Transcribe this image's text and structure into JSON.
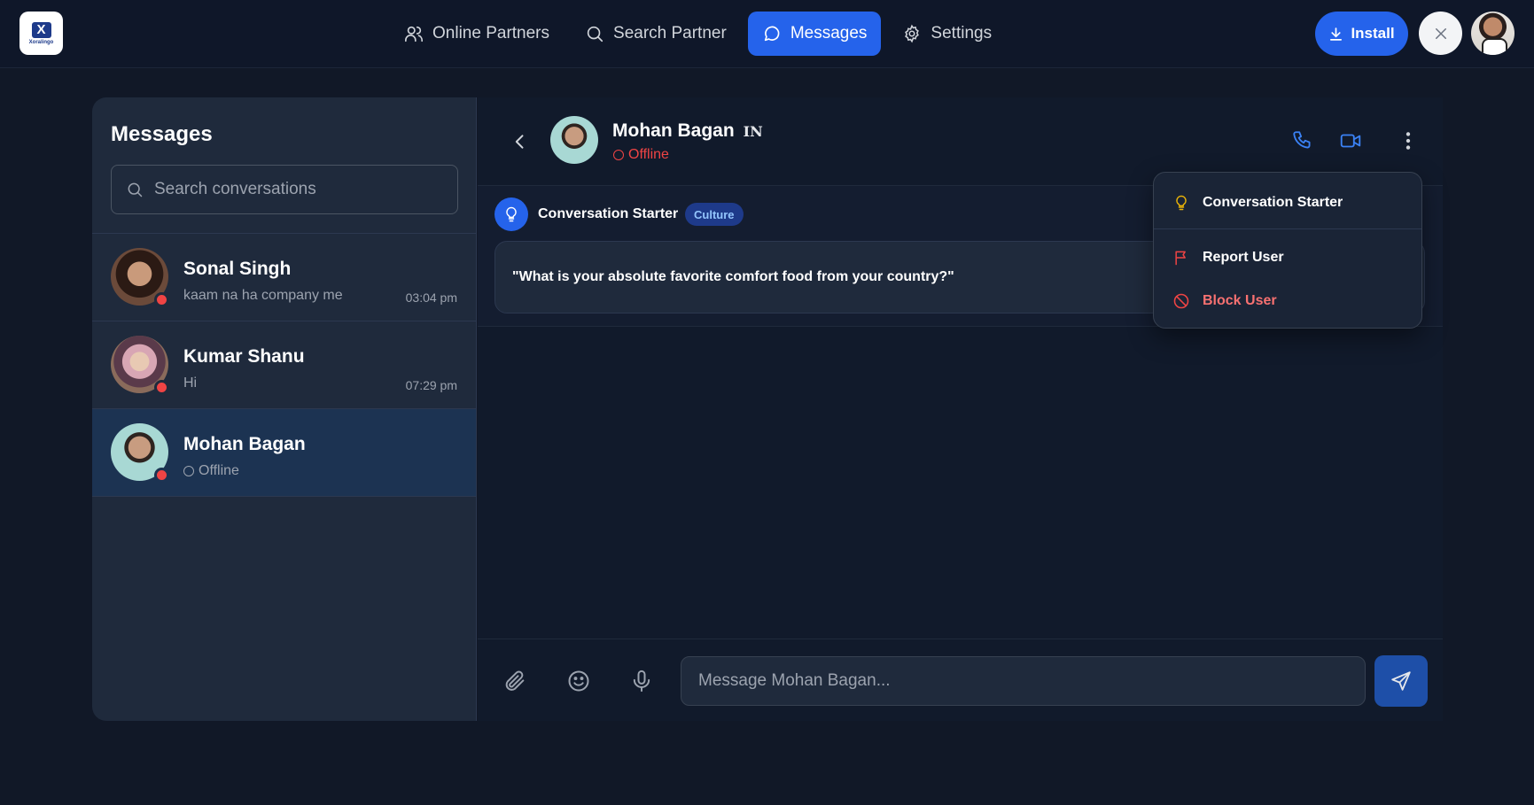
{
  "app": {
    "logo_text": "Xoralingo"
  },
  "nav": {
    "items": [
      {
        "label": "Online Partners",
        "icon": "users-icon"
      },
      {
        "label": "Search Partner",
        "icon": "search-icon"
      },
      {
        "label": "Messages",
        "icon": "chat-bubble-icon",
        "active": true
      },
      {
        "label": "Settings",
        "icon": "gear-icon"
      }
    ],
    "install_label": "Install"
  },
  "sidebar": {
    "title": "Messages",
    "search_placeholder": "Search conversations",
    "conversations": [
      {
        "name": "Sonal Singh",
        "preview": "kaam na ha company me",
        "time": "03:04 pm",
        "status": "offline"
      },
      {
        "name": "Kumar Shanu",
        "preview": "Hi",
        "time": "07:29 pm",
        "status": "offline"
      },
      {
        "name": "Mohan Bagan",
        "preview": "Offline",
        "time": "",
        "status": "offline",
        "active": true
      }
    ]
  },
  "chat": {
    "name": "Mohan Bagan",
    "country_code": "IN",
    "status": "Offline",
    "starter": {
      "title": "Conversation Starter",
      "tag": "Culture",
      "question": "\"What is your absolute favorite comfort food from your country?\""
    },
    "composer_placeholder": "Message Mohan Bagan..."
  },
  "menu": {
    "items": [
      {
        "label": "Conversation Starter",
        "icon": "lightbulb-icon"
      },
      {
        "label": "Report User",
        "icon": "flag-icon"
      },
      {
        "label": "Block User",
        "icon": "block-icon"
      }
    ]
  },
  "colors": {
    "accent": "#2563eb",
    "danger": "#ef4444",
    "background": "#111827"
  }
}
